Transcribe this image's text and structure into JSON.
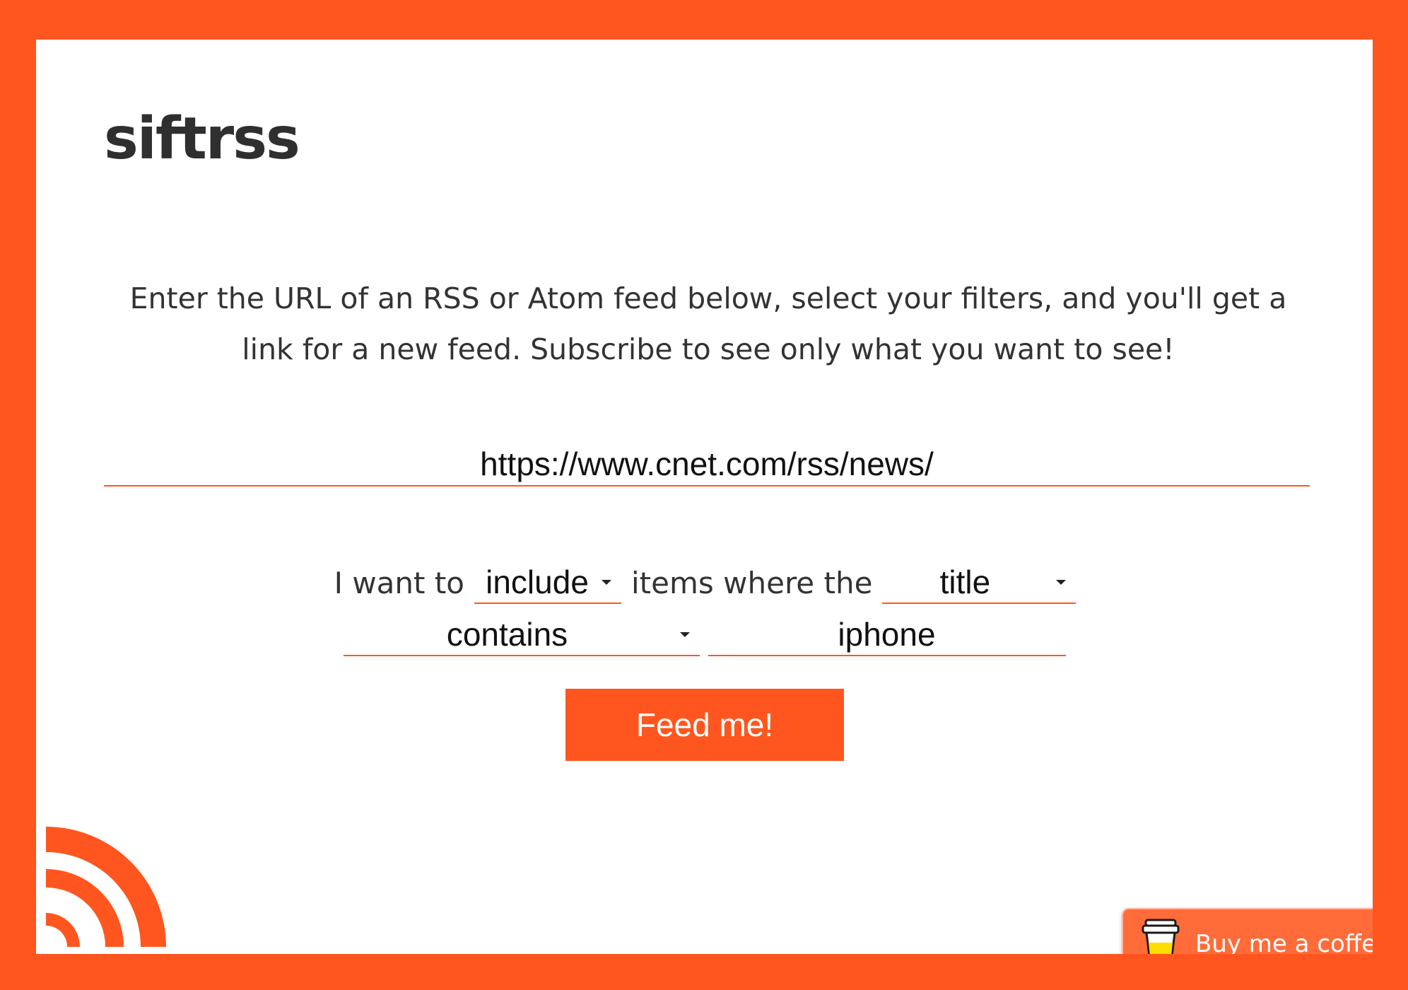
{
  "app": {
    "title": "siftrss",
    "intro": "Enter the URL of an RSS or Atom feed below, select your filters, and you'll get a link for a new feed. Subscribe to see only what you want to see!"
  },
  "form": {
    "feed_url": "https://www.cnet.com/rss/news/",
    "sentence": {
      "prefix": "I want to",
      "action": "include",
      "middle": "items where the",
      "field": "title",
      "operator": "contains",
      "value": "iphone"
    },
    "submit_label": "Feed me!"
  },
  "footer": {
    "coffee_label": "Buy me a coffee",
    "coffee_icon": "coffee-cup-icon",
    "logo_icon": "rss-icon"
  },
  "colors": {
    "accent": "#ff561f",
    "coffee_button": "#ff6c3a",
    "text": "#333333"
  }
}
